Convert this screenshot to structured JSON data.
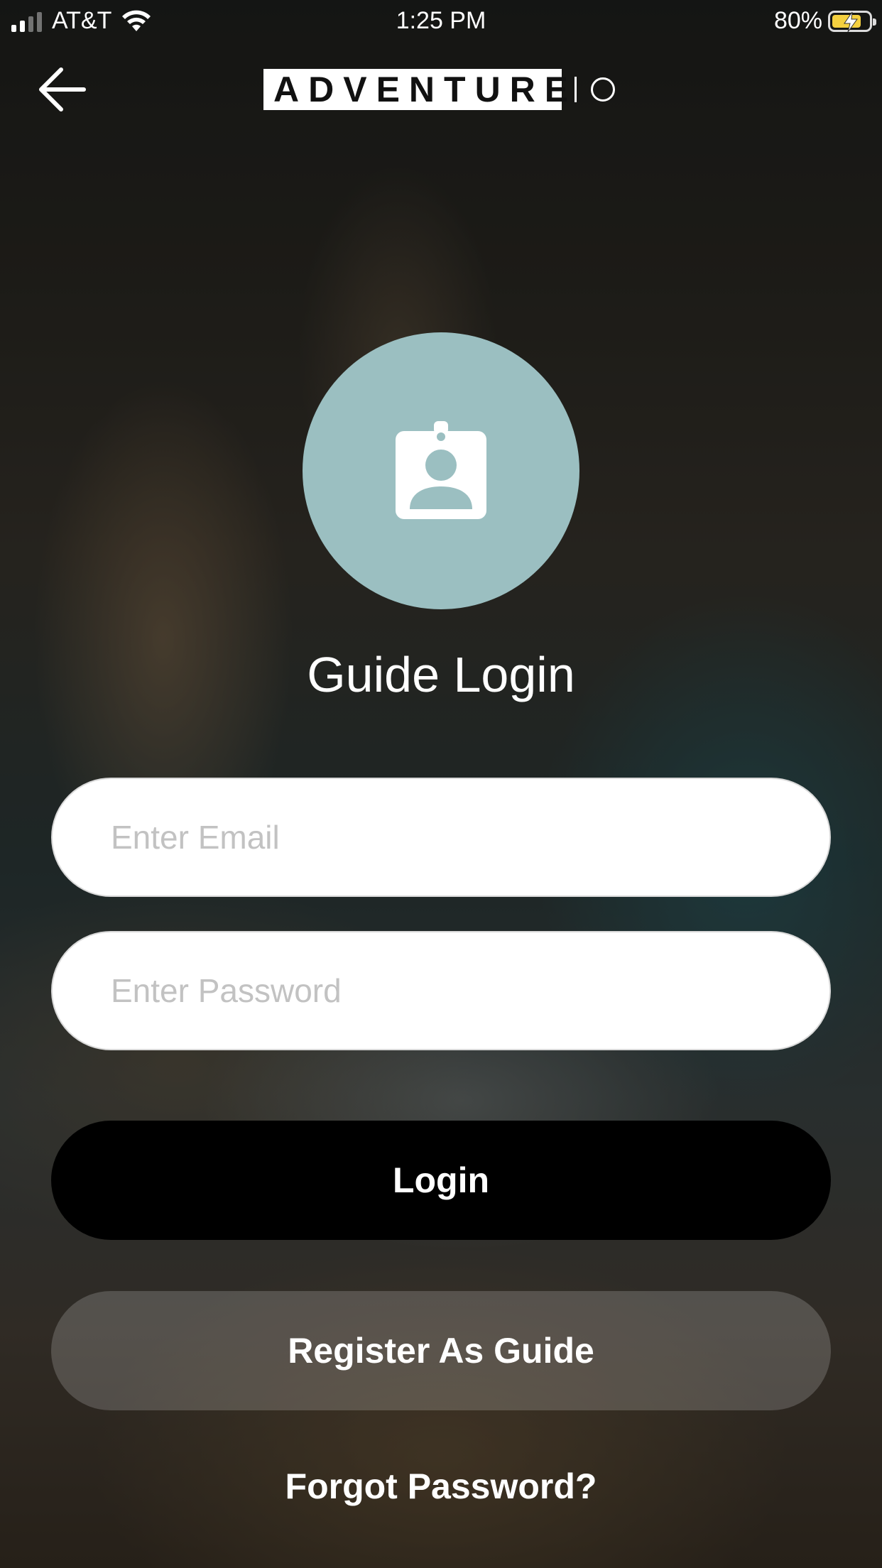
{
  "status_bar": {
    "carrier": "AT&T",
    "time": "1:25 PM",
    "battery_percent": "80%",
    "battery_level": 0.8,
    "signal_bars_active": 2,
    "signal_bars_total": 4
  },
  "header": {
    "back_icon": "arrow-left-icon",
    "logo_text": "ADVENTURE"
  },
  "login": {
    "avatar_icon": "id-badge-icon",
    "avatar_color": "#9bbfc1",
    "title": "Guide Login",
    "email_placeholder": "Enter Email",
    "password_placeholder": "Enter Password",
    "login_label": "Login",
    "register_label": "Register As Guide",
    "forgot_label": "Forgot Password?"
  }
}
